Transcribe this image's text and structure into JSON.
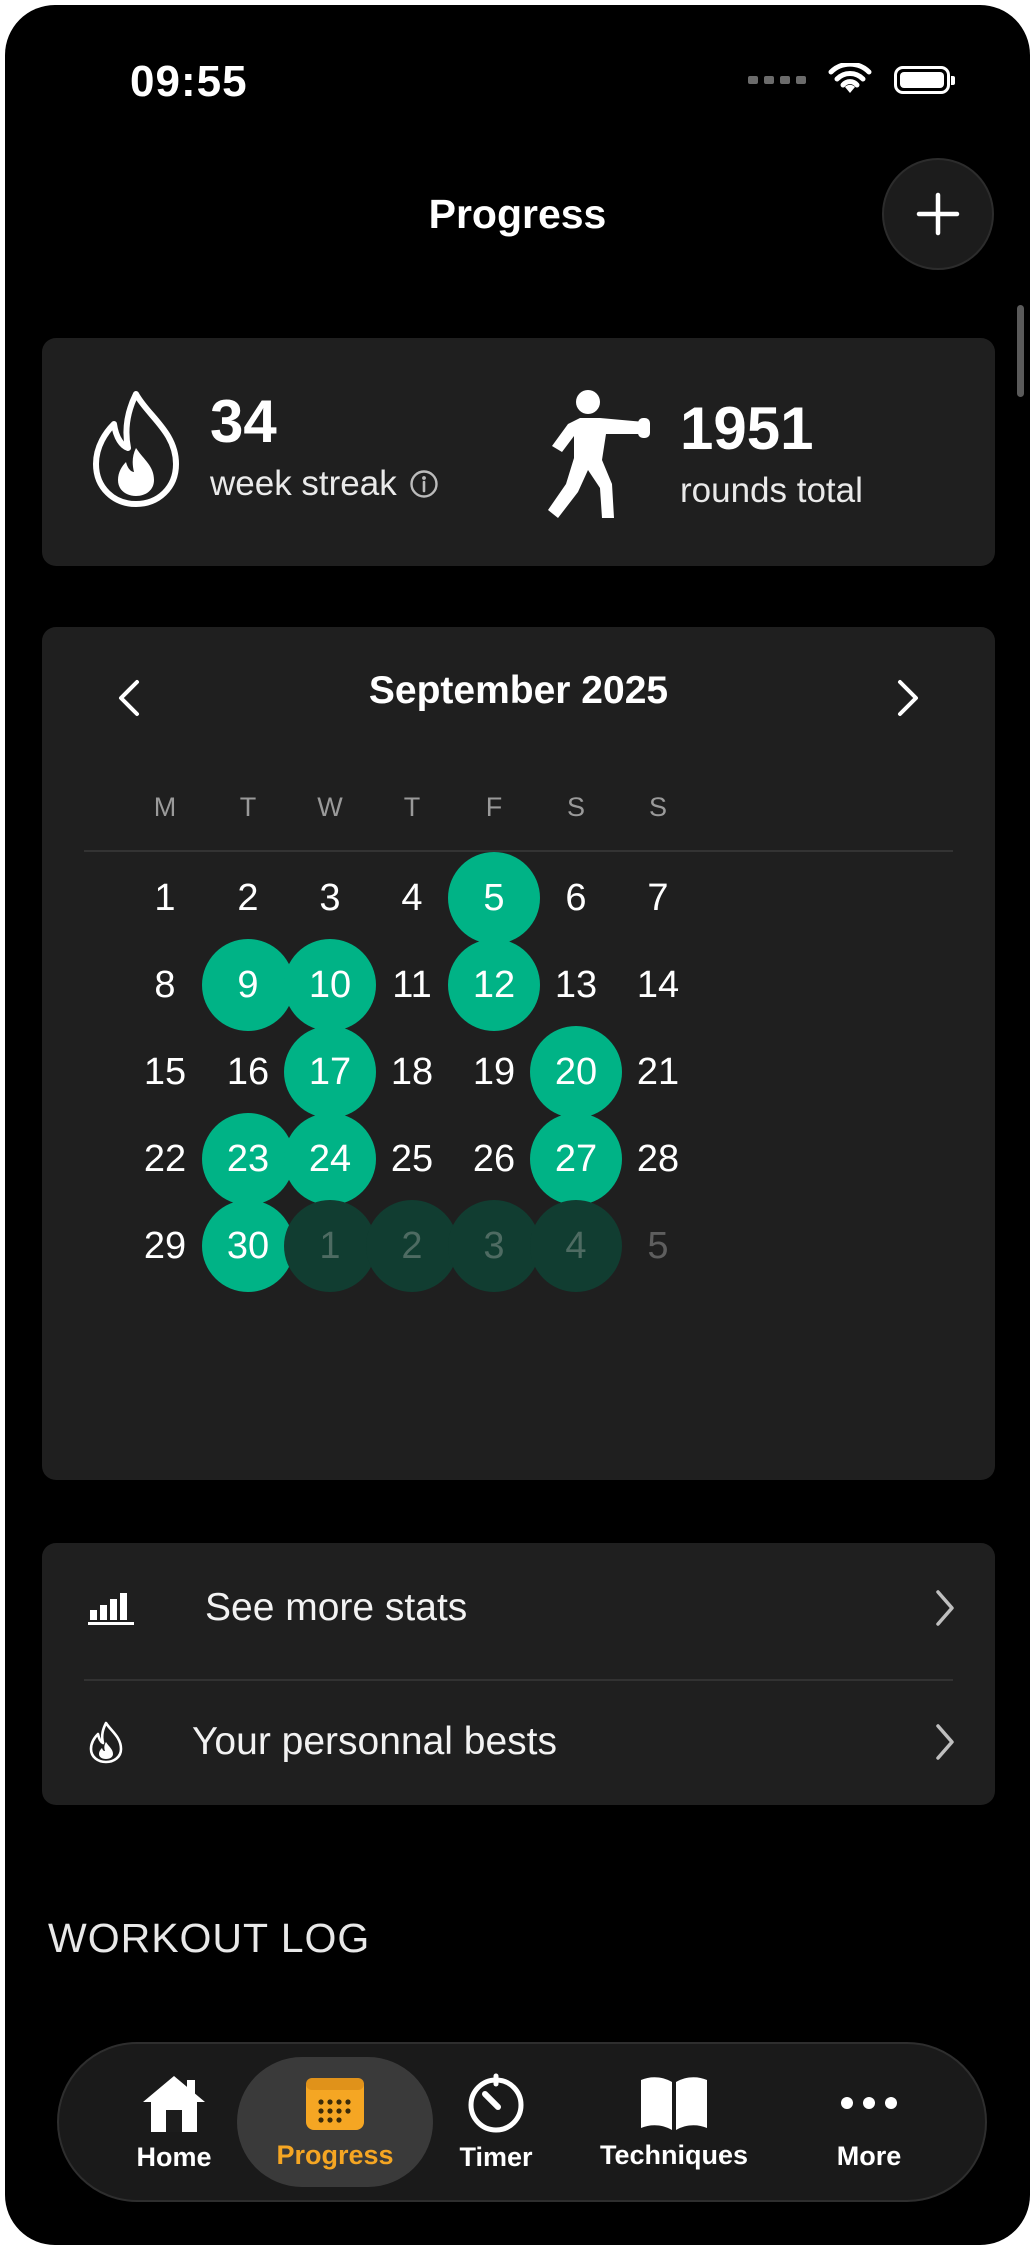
{
  "status": {
    "time": "09:55"
  },
  "header": {
    "title": "Progress"
  },
  "summary": {
    "streak_value": "34",
    "streak_label": "week streak",
    "rounds_value": "1951",
    "rounds_label": "rounds total"
  },
  "calendar": {
    "month_label": "September 2025",
    "weekdays": [
      "M",
      "T",
      "W",
      "T",
      "F",
      "S",
      "S"
    ],
    "days": [
      [
        "1",
        "2",
        "3",
        "4",
        "5",
        "6",
        "7"
      ],
      [
        "8",
        "9",
        "10",
        "11",
        "12",
        "13",
        "14"
      ],
      [
        "15",
        "16",
        "17",
        "18",
        "19",
        "20",
        "21"
      ],
      [
        "22",
        "23",
        "24",
        "25",
        "26",
        "27",
        "28"
      ],
      [
        "29",
        "30",
        "1",
        "2",
        "3",
        "4",
        "5"
      ]
    ],
    "workout_days": [
      "5",
      "9",
      "10",
      "12",
      "17",
      "20",
      "23",
      "24",
      "27",
      "30"
    ],
    "next_month_workout_days": [
      "1",
      "2",
      "3",
      "4"
    ],
    "colors": {
      "active": "#00b386",
      "next_month_active": "#113d31"
    }
  },
  "links": {
    "stats_label": "See more stats",
    "bests_label": "Your personnal bests"
  },
  "workout_log": {
    "title": "WORKOUT LOG"
  },
  "tabbar": {
    "home": "Home",
    "progress": "Progress",
    "timer": "Timer",
    "techniques": "Techniques",
    "more": "More",
    "accent": "#f5a623"
  }
}
